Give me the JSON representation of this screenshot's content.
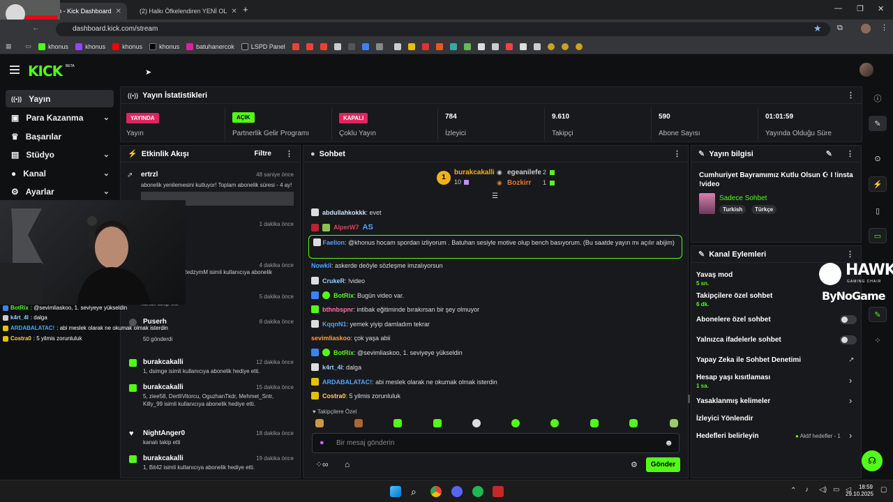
{
  "browser": {
    "tabs": [
      {
        "label": "Stream - Kick Dashboard",
        "active": true
      },
      {
        "label": "(2) Halkı Öfkelendiren YENİ OL",
        "active": false
      }
    ],
    "url": "dashboard.kick.com/stream",
    "bookmarks": [
      "khonus",
      "khonus",
      "khonus",
      "khonus",
      "batuhanercok",
      "LSPD Panel"
    ]
  },
  "sidebar": {
    "items": [
      {
        "label": "Yayın",
        "icon": "broadcast-icon"
      },
      {
        "label": "Para Kazanma",
        "icon": "money-icon"
      },
      {
        "label": "Başarılar",
        "icon": "trophy-icon"
      },
      {
        "label": "Stüdyo",
        "icon": "studio-icon"
      },
      {
        "label": "Kanal",
        "icon": "user-icon"
      },
      {
        "label": "Ayarlar",
        "icon": "gear-icon"
      }
    ]
  },
  "stats": {
    "title": "Yayın İstatistikleri",
    "cells": [
      {
        "badge": "YAYINDA",
        "label": "Yayın"
      },
      {
        "badge": "AÇIK",
        "label": "Partnerlik Gelir Programı"
      },
      {
        "badge": "KAPALI",
        "label": "Çoklu Yayın"
      },
      {
        "value": "784",
        "label": "İzleyici"
      },
      {
        "value": "9.610",
        "label": "Takipçi"
      },
      {
        "value": "590",
        "label": "Abone Sayısı"
      },
      {
        "value": "01:01:59",
        "label": "Yayında Olduğu Süre"
      }
    ]
  },
  "events": {
    "title": "Etkinlik Akışı",
    "filter": "Filtre",
    "items": [
      {
        "name": "ertrzl",
        "time": "48 saniye önce",
        "desc": "abonelik yenilemesini kutluyor! Toplam abonelik süresi - 4 ay!"
      },
      {
        "name": "",
        "time": "1 dakika önce",
        "desc": ""
      },
      {
        "name": "",
        "time": "4 dakika önce",
        "desc": "RedzymM isimli kullanıcıya abonelik"
      },
      {
        "name": "",
        "time": "5 dakika önce",
        "desc": "kanalı takip etti"
      },
      {
        "name": "Puserh",
        "time": "8 dakika önce",
        "desc": "50 gönderdi"
      },
      {
        "name": "burakcakalli",
        "time": "12 dakika önce",
        "desc": "1, dsimge isimli kullanıcıya abonelik hediye etti."
      },
      {
        "name": "burakcakalli",
        "time": "15 dakika önce",
        "desc": "5, ziee58, DertliVitorcu, OguzhanTkdr, Mehmet_Sntr, Killy_99 isimli kullanıcıya abonelik hediye etti."
      },
      {
        "name": "NightAnger0",
        "time": "18 dakika önce",
        "desc": "kanalı takip etti"
      },
      {
        "name": "burakcakalli",
        "time": "19 dakika önce",
        "desc": "1, Bit42 isimli kullanıcıya abonelik hediye etti."
      }
    ]
  },
  "chat": {
    "title": "Sohbet",
    "leaders": {
      "top": {
        "name": "burakcakalli",
        "count": "10"
      },
      "second": {
        "name": "egeanilefe",
        "count": "2"
      },
      "third": {
        "name": "Bozkirr",
        "count": "1"
      }
    },
    "messages": [
      {
        "user": "abdullahkokkk",
        "text": "evet",
        "color": "#cfe2ff"
      },
      {
        "user": "AlperW7",
        "text": "AS",
        "color": "#e0425b"
      },
      {
        "user": "Faelion",
        "text": "@khonus hocam spordan izliyorum . Batuhan sesiyle motive olup bench basıyorum. (Bu saatde yayın mı açılır abijim)",
        "color": "#4ea4ff"
      },
      {
        "user": "Nowkil",
        "text": "askerde deöyle sözleşme imzalıyorsun",
        "color": "#4ea4ff"
      },
      {
        "user": "CrukeR",
        "text": "!video",
        "color": "#8fd3ff"
      },
      {
        "user": "BotRix",
        "text": "Bugün video var.",
        "color": "#53fc18"
      },
      {
        "user": "bthnbspnr",
        "text": "intibak eğitiminde bırakırsan bir şey olmuyor",
        "color": "#ff6fb0"
      },
      {
        "user": "KqqnN1",
        "text": "yemek yiyip damladım tekrar",
        "color": "#4ea4ff"
      },
      {
        "user": "sevimliaskoo",
        "text": "çok yaşa abii",
        "color": "#ff9d3f"
      },
      {
        "user": "BotRix",
        "text": "@sevimliaskoo, 1. seviyeye yükseldin",
        "color": "#53fc18"
      },
      {
        "user": "k4rt_4l",
        "text": "dalga",
        "color": "#9cf"
      },
      {
        "user": "ARDABALATAC!",
        "text": "abi meslek olarak ne okumak olmak isterdin",
        "color": "#4ea4ff"
      },
      {
        "user": "Costra0",
        "text": "5 yilmis zorunluluk",
        "color": "#ffd34d"
      }
    ],
    "followers_only": "Takipçilere Özel",
    "placeholder": "Bir mesaj gönderin",
    "send": "Gönder"
  },
  "stream_info": {
    "title": "Yayın bilgisi",
    "stream_title": "Cumhuriyet Bayramımız Kutlu Olsun ☪ I !insta !video",
    "category": "Sadece Sohbet",
    "tags": [
      "Turkish",
      "Türkçe"
    ]
  },
  "channel_actions": {
    "title": "Kanal Eylemleri",
    "items": [
      {
        "label": "Yavaş mod",
        "sub": "5 sn."
      },
      {
        "label": "Takipçilere özel sohbet",
        "sub": "6 dk."
      },
      {
        "label": "Abonelere özel sohbet",
        "sub": ""
      },
      {
        "label": "Yalnızca ifadelerle sohbet",
        "sub": ""
      },
      {
        "label": "Yapay Zeka ile Sohbet Denetimi",
        "sub": ""
      },
      {
        "label": "Hesap yaşı kısıtlaması",
        "sub": "1 sa."
      },
      {
        "label": "Yasaklanmış kelimeler",
        "sub": ""
      },
      {
        "label": "İzleyici Yönlendir",
        "sub": ""
      },
      {
        "label": "Hedefleri belirleyin",
        "sub": ""
      }
    ],
    "goals_status": "Aktif hedefler - 1"
  },
  "overlay_chat": [
    {
      "user": "BotRix",
      "text": ": @sevimliaskoo, 1. seviyeye yükseldin"
    },
    {
      "user": "k4rt_4l",
      "text": ": dalga"
    },
    {
      "user": "ARDABALATAC!",
      "text": ": abi meslek olarak ne okumak olmak isterdin"
    },
    {
      "user": "Costra0",
      "text": ": 5 yilmis zorunluluk"
    }
  ],
  "sponsor": {
    "brand": "HAWK",
    "sub": "GAMING CHAIR",
    "handle": "ByNoGame"
  },
  "taskbar": {
    "time": "18:59",
    "date": "29.10.2025"
  }
}
